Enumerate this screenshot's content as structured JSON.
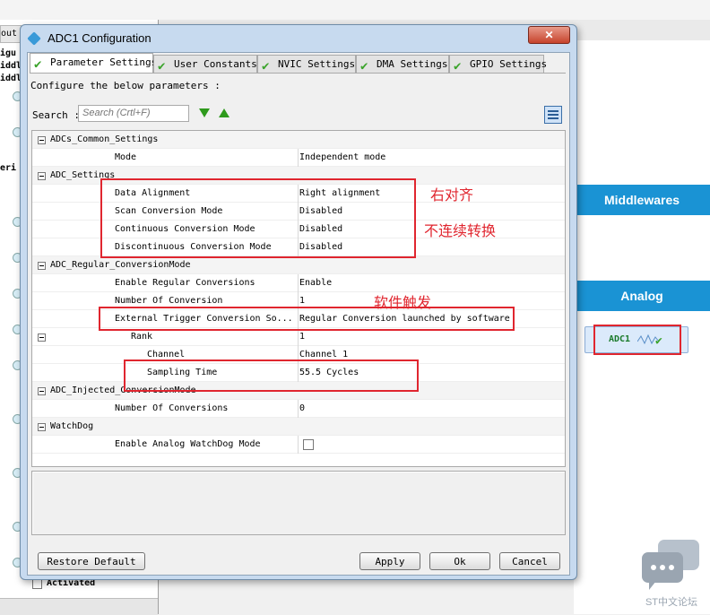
{
  "background": {
    "left_tab_text": "out",
    "left_labels": [
      "igu",
      "iddl",
      "iddl",
      "eri"
    ],
    "middlewares_label": "Middlewares",
    "analog_label": "Analog",
    "adc_chip_label": "ADC1",
    "activated_label": "Activated",
    "logo_text": "ST中文论坛"
  },
  "dialog": {
    "title": "ADC1 Configuration",
    "close_label": "✕",
    "tabs": [
      {
        "label": "Parameter Settings"
      },
      {
        "label": "User Constants"
      },
      {
        "label": "NVIC Settings"
      },
      {
        "label": "DMA Settings"
      },
      {
        "label": "GPIO Settings"
      }
    ],
    "hint": "Configure the below parameters :",
    "search_label": "Search :",
    "search_placeholder": "Search (Crtl+F)",
    "groups": {
      "common": "ADCs_Common_Settings",
      "adc": "ADC_Settings",
      "regular": "ADC_Regular_ConversionMode",
      "injected": "ADC_Injected_ConversionMode",
      "watchdog": "WatchDog"
    },
    "params": {
      "mode": {
        "name": "Mode",
        "value": "Independent mode"
      },
      "data_alignment": {
        "name": "Data Alignment",
        "value": "Right alignment"
      },
      "scan_mode": {
        "name": "Scan Conversion Mode",
        "value": "Disabled"
      },
      "continuous_mode": {
        "name": "Continuous Conversion Mode",
        "value": "Disabled"
      },
      "discontinuous_mode": {
        "name": "Discontinuous Conversion Mode",
        "value": "Disabled"
      },
      "enable_regular": {
        "name": "Enable Regular Conversions",
        "value": "Enable"
      },
      "number_of_conversion": {
        "name": "Number Of Conversion",
        "value": "1"
      },
      "external_trigger": {
        "name": "External Trigger Conversion So...",
        "value": "Regular Conversion launched by software"
      },
      "rank": {
        "name": "Rank",
        "value": "1"
      },
      "channel": {
        "name": "Channel",
        "value": "Channel 1"
      },
      "sampling_time": {
        "name": "Sampling Time",
        "value": "55.5 Cycles"
      },
      "number_of_conversions_injected": {
        "name": "Number Of Conversions",
        "value": "0"
      },
      "enable_watchdog": {
        "name": "Enable Analog WatchDog Mode",
        "checked": false
      }
    },
    "buttons": {
      "restore_default": "Restore Default",
      "apply": "Apply",
      "ok": "Ok",
      "cancel": "Cancel"
    }
  },
  "annotations": {
    "right_align": "右对齐",
    "non_continuous": "不连续转换",
    "software_trigger": "软件触发"
  },
  "colors": {
    "accent_blue": "#1a93d4",
    "annotation_red": "#e0262f",
    "check_green": "#3aa32a"
  }
}
